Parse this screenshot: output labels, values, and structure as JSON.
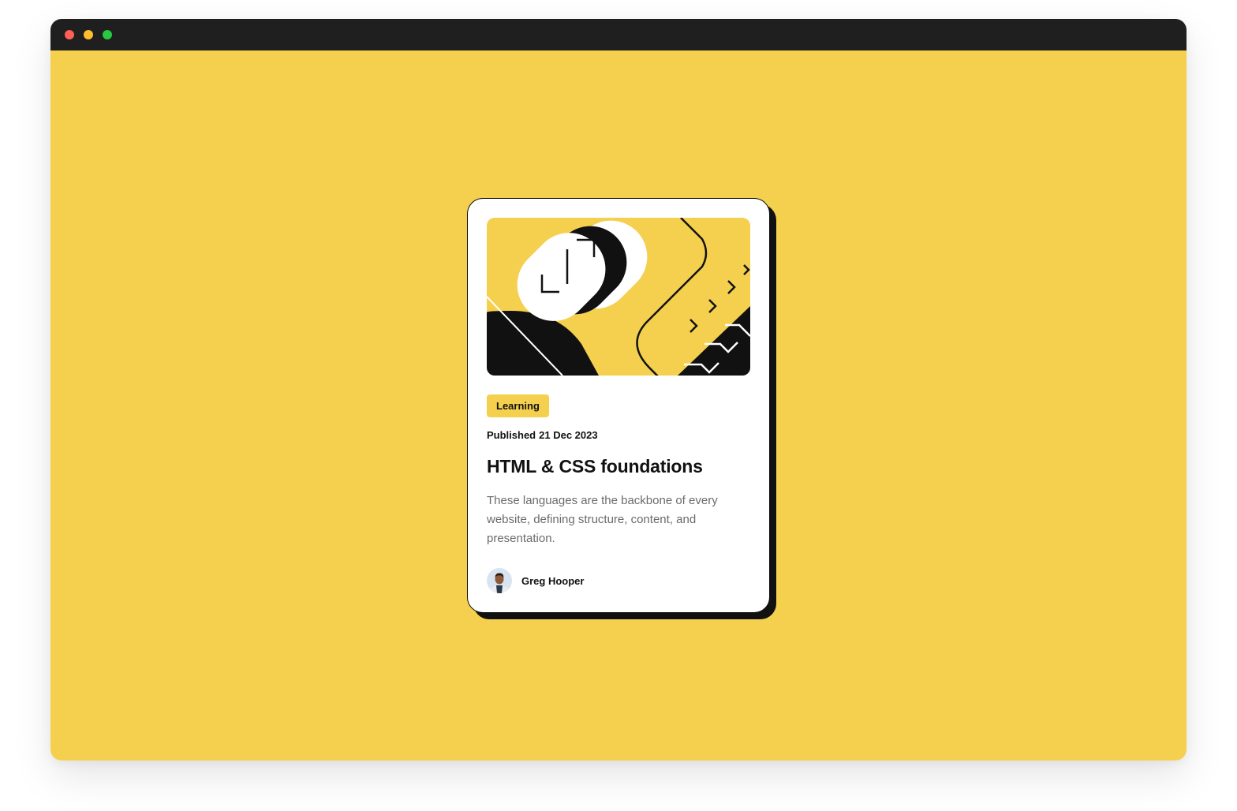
{
  "colors": {
    "page_background": "#f4d04e",
    "titlebar": "#1f1f1f",
    "dot_red": "#ff5f57",
    "dot_yellow": "#febc2e",
    "dot_green": "#28c840",
    "tag_background": "#f4d04e",
    "ink": "#111111",
    "muted_text": "#6b6b6b"
  },
  "card": {
    "hero_illustration": "abstract-code-illustration",
    "tag": "Learning",
    "published_label": "Published",
    "published_date": "21 Dec 2023",
    "title": "HTML & CSS foundations",
    "description": "These languages are the backbone of every website, defining structure, content, and presentation.",
    "author": {
      "name": "Greg Hooper",
      "avatar_icon": "person-avatar-icon"
    }
  }
}
